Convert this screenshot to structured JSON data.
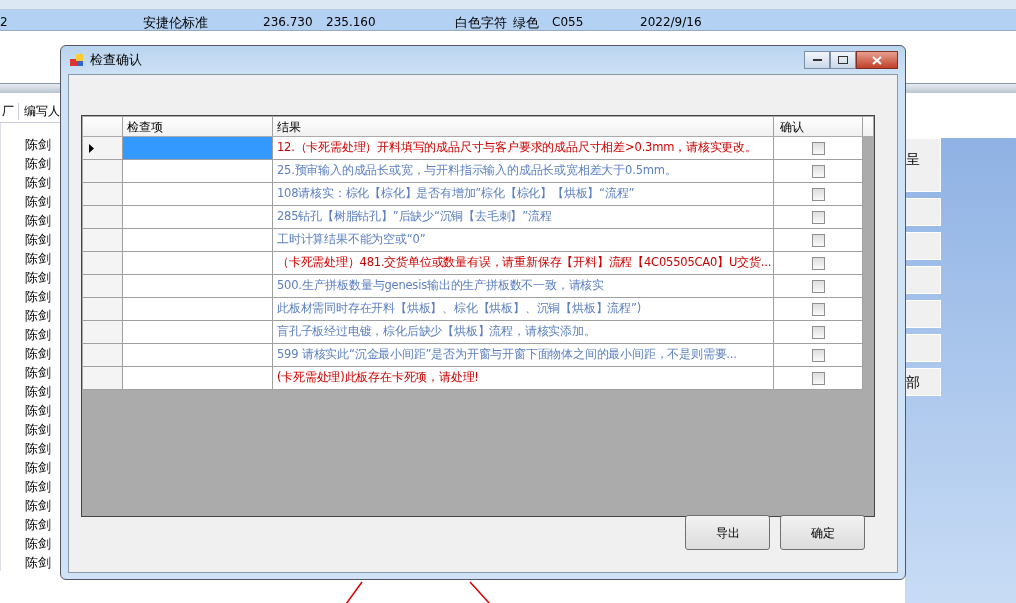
{
  "background_table": {
    "row": {
      "selected": true,
      "cells": [
        "2",
        "安捷伦标准",
        "236.730",
        "235.160",
        "白色字符",
        "绿色",
        "C055",
        "2022/9/16"
      ]
    },
    "columns": [
      "厂",
      "编写人"
    ],
    "writers": [
      "陈剑",
      "陈剑",
      "陈剑",
      "陈剑",
      "陈剑",
      "陈剑",
      "陈剑",
      "陈剑",
      "陈剑",
      "陈剑",
      "陈剑",
      "陈剑",
      "陈剑",
      "陈剑",
      "陈剑",
      "陈剑",
      "陈剑",
      "陈剑",
      "陈剑",
      "陈剑",
      "陈剑",
      "陈剑",
      "陈剑"
    ]
  },
  "side_panel": {
    "labels": [
      "呈",
      "部"
    ]
  },
  "dialog": {
    "title": "检查确认",
    "columns": [
      "检查项",
      "结果",
      "确认"
    ],
    "rows": [
      {
        "result": "12.（卡死需处理）开料填写的成品尺寸与客户要求的成品尺寸相差>0.3mm，请核实更改。",
        "color": "#cc0000",
        "selected": true,
        "checked": false
      },
      {
        "result": "25.预审输入的成品长或宽，与开料指示输入的成品长或宽相差大于0.5mm。",
        "color": "#5b7fc0",
        "selected": false,
        "checked": false
      },
      {
        "result": "108请核实：棕化【棕化】是否有增加”棕化【棕化】【烘板】“流程”",
        "color": "#5b7fc0",
        "selected": false,
        "checked": false
      },
      {
        "result": "285钻孔【树脂钻孔】”后缺少“沉铜【去毛刺】”流程",
        "color": "#5b7fc0",
        "selected": false,
        "checked": false
      },
      {
        "result": "工时计算结果不能为空或“0”",
        "color": "#5b7fc0",
        "selected": false,
        "checked": false
      },
      {
        "result": "（卡死需处理）481.交货单位或数量有误，请重新保存【开料】流程【4C05505CA0】U交货...",
        "color": "#cc0000",
        "selected": false,
        "checked": false
      },
      {
        "result": "500.生产拼板数量与genesis输出的生产拼板数不一致，请核实",
        "color": "#5b7fc0",
        "selected": false,
        "checked": false
      },
      {
        "result": "此板材需同时存在开料【烘板】、棕化【烘板】、沉铜【烘板】流程”)",
        "color": "#5b7fc0",
        "selected": false,
        "checked": false
      },
      {
        "result": "盲孔子板经过电镀，棕化后缺少【烘板】流程，请核实添加。",
        "color": "#5b7fc0",
        "selected": false,
        "checked": false
      },
      {
        "result": "599 请核实此“沉金最小间距”是否为开窗与开窗下面物体之间的最小间距，不是则需要...",
        "color": "#5b7fc0",
        "selected": false,
        "checked": false
      },
      {
        "result": "(卡死需处理)此板存在卡死项，请处理!",
        "color": "#cc0000",
        "selected": false,
        "checked": false
      }
    ],
    "buttons": [
      "导出",
      "确定"
    ]
  }
}
